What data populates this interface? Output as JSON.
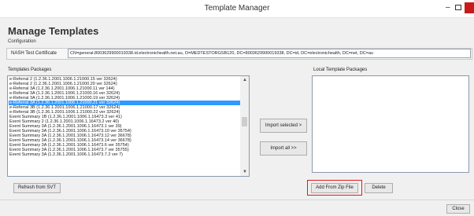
{
  "window": {
    "title": "Template Manager",
    "min_glyph": "–",
    "close_color": "#c81a1a"
  },
  "header": {
    "title": "Manage Templates",
    "subtitle": "Configuration"
  },
  "nash": {
    "label": "NASH Test Certificate",
    "value": "CN=general.8003629900019338.id.electronichealth.net.au, O=MEDTESTORGSB120, DC=8003629900019338, DC=id, DC=electronichealth, DC=net, DC=au"
  },
  "templates_packages": {
    "label": "Templates Packages",
    "selected_index": 5,
    "items": [
      "e-Referral 2 (1.2.36.1.2001.1006.1.21000.15 ver 32624)",
      "e-Referral 2 (1.2.36.1.2001.1006.1.21000.20 ver 32624)",
      "e-Referral 3A (1.2.36.1.2001.1006.1.21000.11 ver 144)",
      "e-Referral 3A (1.2.36.1.2001.1006.1.21000.16 ver 32624)",
      "e-Referral 3A (1.2.36.1.2001.1006.1.21000.19 ver 32624)",
      "e-Referral 3A (1.2.36.1.2001.1006.1.21000.21 ver 32624)",
      "e-Referral 3B (1.2.36.1.2001.1006.1.21000.17 ver 32624)",
      "e-Referral 3B (1.2.36.1.2001.1006.1.21000.22 ver 32624)",
      "Event Summary 1B (1.2.36.1.2001.1006.1.16473.3 ver 41)",
      "Event Summary 2 (1.2.36.1.2001.1006.1.16473.2 ver 40)",
      "Event Summary 3A (1.2.36.1.2001.1006.1.16473.1 ver 39)",
      "Event Summary 3A (1.2.36.1.2001.1006.1.16473.10 ver 35754)",
      "Event Summary 3A (1.2.36.1.2001.1006.1.16473.12 ver 36678)",
      "Event Summary 3A (1.2.36.1.2001.1006.1.16473.14 ver 36678)",
      "Event Summary 3A (1.2.36.1.2001.1006.1.16473.6 ver 35754)",
      "Event Summary 3A (1.2.36.1.2001.1006.1.16473.7 ver 35755)",
      "Event Summary 3A (1.2.36.1.2001.1006.1.16473.7.2 ver 7)"
    ]
  },
  "local_packages": {
    "label": "Local Template Packages"
  },
  "buttons": {
    "import_selected": "Import selected >",
    "import_all": "Import all >>",
    "refresh": "Refresh from SVT",
    "add_zip": "Add From Zip File",
    "delete": "Delete",
    "close": "Close"
  },
  "colors": {
    "selection": "#3399ff",
    "highlight": "#e11b1b"
  }
}
